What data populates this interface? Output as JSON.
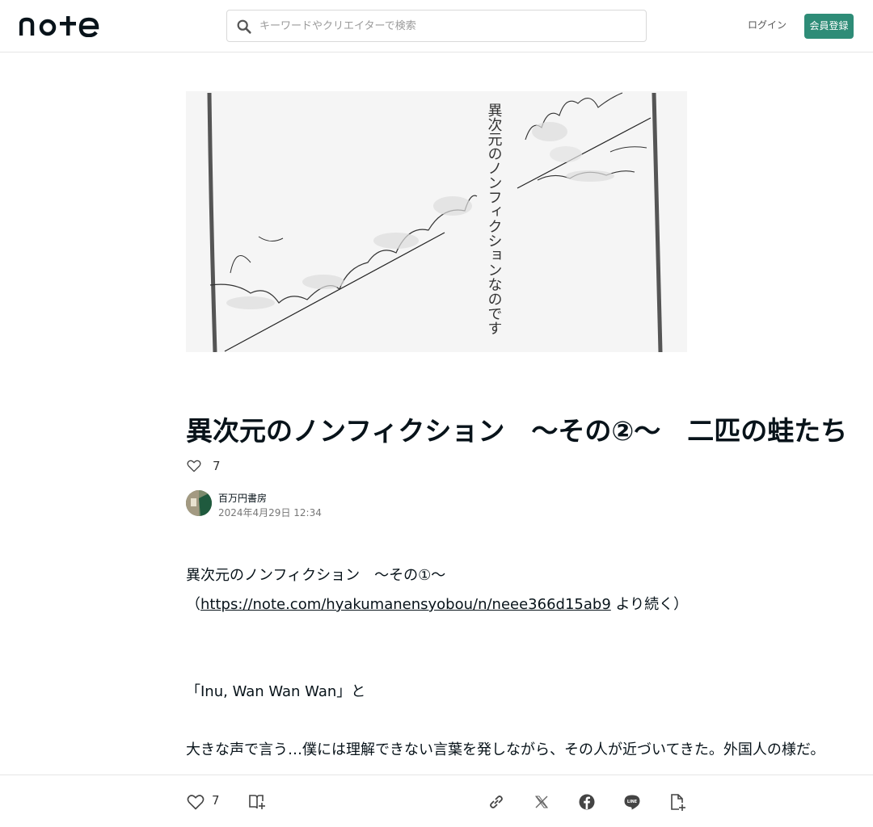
{
  "header": {
    "logo_text": "note",
    "search_placeholder": "キーワードやクリエイターで検索",
    "login_label": "ログイン",
    "signup_label": "会員登録",
    "accent_color": "#2e8c77"
  },
  "eyecatch": {
    "vertical_text": "異次元のノンフィクションなのです"
  },
  "article": {
    "title": "異次元のノンフィクション　～その②～　二匹の蛙たち",
    "like_count": "7",
    "author_name": "百万円書房",
    "date": "2024年4月29日 12:34",
    "p1": "異次元のノンフィクション　～その①～",
    "p2_prefix": "（",
    "p2_link": "https://note.com/hyakumanensyobou/n/neee366d15ab9",
    "p2_suffix": " より続く）",
    "p3": "「Inu, Wan Wan Wan」と",
    "p4": "大きな声で言う…僕には理解できない言葉を発しながら、その人が近づいてきた。外国人の様だ。"
  },
  "bottom_bar": {
    "like_count": "7",
    "icons": [
      "heart-icon",
      "magazine-add-icon",
      "link-icon",
      "x-icon",
      "facebook-icon",
      "line-icon",
      "clip-icon"
    ]
  }
}
